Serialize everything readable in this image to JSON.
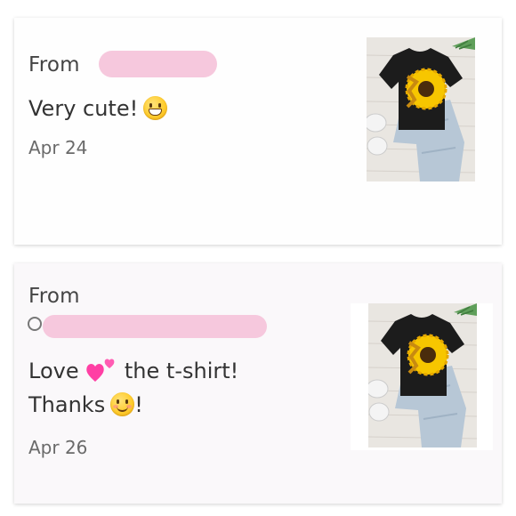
{
  "reviews": [
    {
      "from_label": "From",
      "message": "Very cute!",
      "emoji": "grinning-face-emoji",
      "date": "Apr 24",
      "photo": "black-sunflower-tshirt-photo"
    },
    {
      "from_label": "From",
      "message_part1": "Love",
      "message_part2": "the t-shirt!",
      "message_line2": "Thanks",
      "message_line2_end": "!",
      "emoji_hearts": "two-hearts-emoji",
      "emoji": "smiling-face-emoji",
      "date": "Apr 26",
      "photo": "black-sunflower-tshirt-photo"
    }
  ],
  "colors": {
    "redaction": "#f6c8dd",
    "tshirt": "#1c1c1c",
    "sunflower": "#f7c600"
  }
}
